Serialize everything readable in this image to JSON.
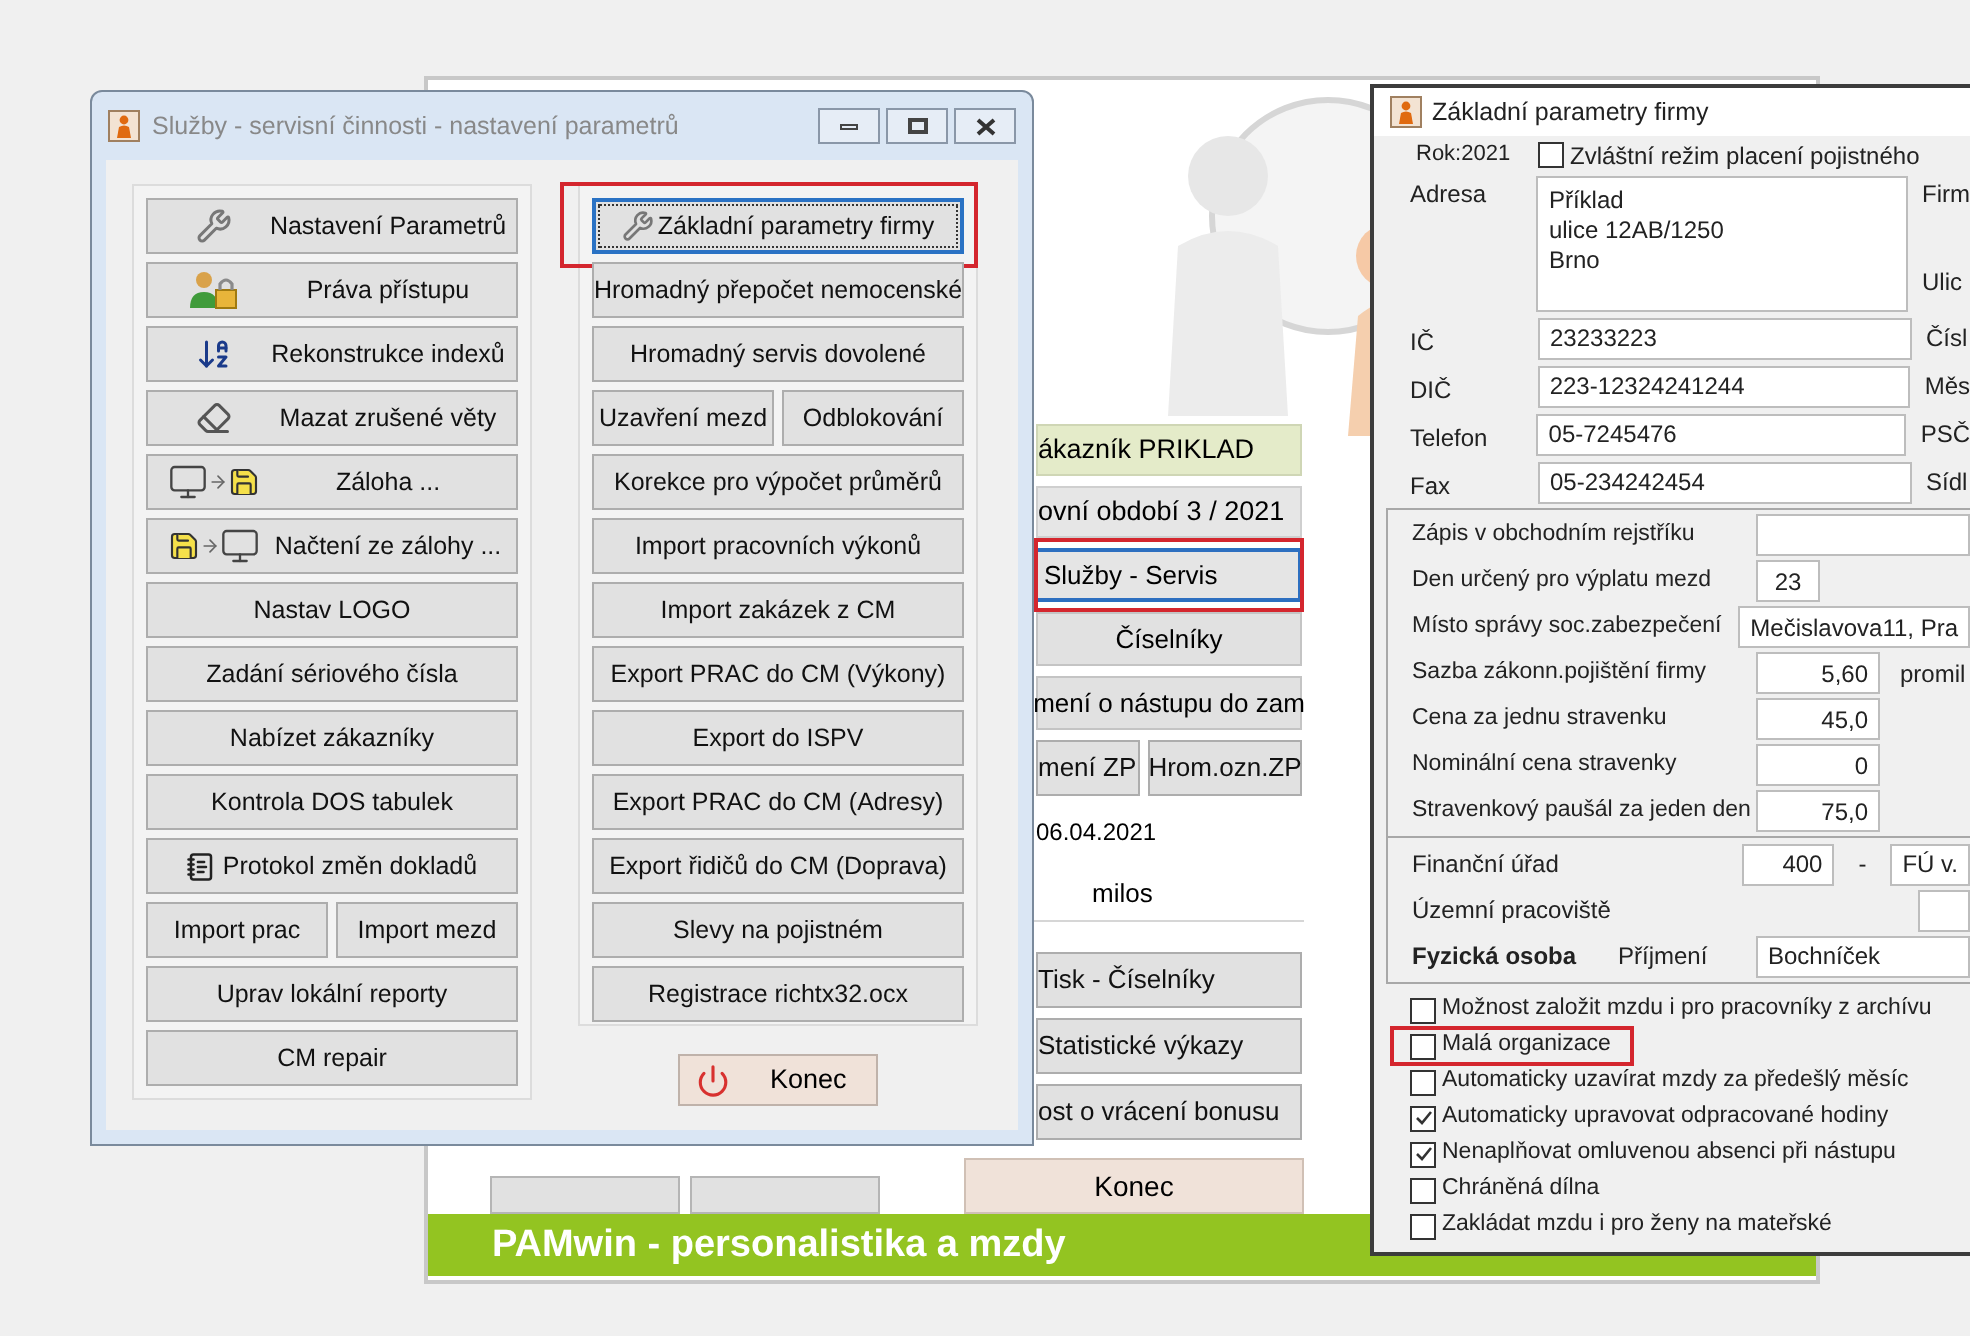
{
  "main_window": {
    "customer": "ákazník  PRIKLAD",
    "period": "ovní období  3 / 2021",
    "menu": [
      {
        "label": "Služby - Servis",
        "selected": true,
        "highlighted": true
      },
      {
        "label": "Číselníky",
        "selected": false,
        "highlighted": false
      },
      {
        "label": "mení o nástupu do zam",
        "selected": false,
        "highlighted": false
      }
    ],
    "pair": [
      "mení ZP",
      "Hrom.ozn.ZP"
    ],
    "date": "06.04.2021",
    "user": "milos",
    "actions": [
      "Tisk - Číselníky",
      "Statistické výkazy",
      "ost o vrácení bonusu"
    ],
    "exit": "Konec",
    "banner": "PAMwin - personalistika a mzdy"
  },
  "service_window": {
    "title": "Služby - servisní činnosti - nastavení parametrů",
    "left": [
      {
        "kind": "single",
        "label": "Nastavení Parametrů"
      },
      {
        "kind": "single",
        "label": "Práva přístupu"
      },
      {
        "kind": "single",
        "label": "Rekonstrukce indexů"
      },
      {
        "kind": "single",
        "label": "Mazat zrušené věty"
      },
      {
        "kind": "single",
        "label": "Záloha ..."
      },
      {
        "kind": "single",
        "label": "Načtení ze zálohy ..."
      },
      {
        "kind": "single",
        "label": "Nastav LOGO"
      },
      {
        "kind": "single",
        "label": "Zadání sériového čísla"
      },
      {
        "kind": "single",
        "label": "Nabízet zákazníky"
      },
      {
        "kind": "single",
        "label": "Kontrola  DOS tabulek"
      },
      {
        "kind": "single",
        "label": "Protokol změn dokladů"
      },
      {
        "kind": "pair",
        "labels": [
          "Import prac",
          "Import  mezd"
        ]
      },
      {
        "kind": "single",
        "label": "Uprav lokální reporty"
      },
      {
        "kind": "single",
        "label": "CM repair"
      }
    ],
    "right": [
      {
        "kind": "single",
        "label": "Základní parametry firmy",
        "focused": true,
        "highlighted": true
      },
      {
        "kind": "single",
        "label": "Hromadný přepočet nemocenské",
        "focused": false,
        "highlighted": false
      },
      {
        "kind": "single",
        "label": "Hromadný servis dovolené",
        "focused": false,
        "highlighted": false
      },
      {
        "kind": "pair",
        "labels": [
          "Uzavření mezd",
          "Odblokování"
        ],
        "focused": false,
        "highlighted": false
      },
      {
        "kind": "single",
        "label": "Korekce pro výpočet průměrů",
        "focused": false,
        "highlighted": false
      },
      {
        "kind": "single",
        "label": "Import pracovních výkonů",
        "focused": false,
        "highlighted": false
      },
      {
        "kind": "single",
        "label": "Import zakázek z CM",
        "focused": false,
        "highlighted": false
      },
      {
        "kind": "single",
        "label": "Export PRAC do CM (Výkony)",
        "focused": false,
        "highlighted": false
      },
      {
        "kind": "single",
        "label": "Export do ISPV",
        "focused": false,
        "highlighted": false
      },
      {
        "kind": "single",
        "label": "Export PRAC do CM (Adresy)",
        "focused": false,
        "highlighted": false
      },
      {
        "kind": "single",
        "label": "Export řidičů do CM (Doprava)",
        "focused": false,
        "highlighted": false
      },
      {
        "kind": "single",
        "label": "Slevy na pojistném",
        "focused": false,
        "highlighted": false
      },
      {
        "kind": "single",
        "label": "Registrace richtx32.ocx",
        "focused": false,
        "highlighted": false
      }
    ],
    "exit": "Konec"
  },
  "firm_window": {
    "title": "Základní parametry firmy",
    "year": "Rok:2021",
    "special": {
      "label": "Zvláštní režim placení pojistného",
      "checked": false
    },
    "address": {
      "label": "Adresa",
      "lines": [
        "Příklad",
        "ulice 12AB/1250",
        "Brno"
      ],
      "side": [
        "Firm",
        "Ulic"
      ]
    },
    "contacts": [
      {
        "label": "IČ",
        "value": "23233223",
        "side": "Čísl"
      },
      {
        "label": "DIČ",
        "value": "223-12324241244",
        "side": "Měs"
      },
      {
        "label": "Telefon",
        "value": "05-7245476",
        "side": "PSČ"
      },
      {
        "label": "Fax",
        "value": "05-234242454",
        "side": "Sídl"
      }
    ],
    "settings": [
      {
        "kind": "wide",
        "label": "Zápis v obchodním rejstříku"
      },
      {
        "kind": "small",
        "label": "Den určený pro výplatu mezd",
        "value": "23"
      },
      {
        "kind": "wide",
        "label": "Místo správy  soc.zabezpečení",
        "value": "Mečislavova11, Pra"
      },
      {
        "kind": "number",
        "label": "Sazba zákonn.pojištění firmy",
        "value": "5,60",
        "unit": "promil"
      },
      {
        "kind": "number",
        "label": "Cena za jednu stravenku",
        "value": "45,0"
      },
      {
        "kind": "number",
        "label": "Nominální cena stravenky",
        "value": "0"
      },
      {
        "kind": "number",
        "label": "Stravenkový paušál za jeden den",
        "value": "75,0"
      }
    ],
    "office": {
      "label": "Finanční úřad",
      "code": "400",
      "dash": "-",
      "name": "FÚ v."
    },
    "branch": {
      "label": "Územní pracoviště"
    },
    "person": {
      "label": "Fyzická osoba",
      "surname_label": "Příjmení",
      "surname": "Bochníček"
    },
    "options": [
      {
        "label": "Možnost založit mzdu i pro pracovníky z archívu",
        "checked": false,
        "highlighted": false
      },
      {
        "label": "Malá organizace",
        "checked": false,
        "highlighted": true
      },
      {
        "label": "Automaticky uzavírat mzdy za předešlý měsíc",
        "checked": false,
        "highlighted": false
      },
      {
        "label": "Automaticky upravovat odpracované hodiny",
        "checked": true,
        "highlighted": false
      },
      {
        "label": "Nenaplňovat omluvenou absenci při nástupu",
        "checked": true,
        "highlighted": false
      },
      {
        "label": "Chráněná dílna",
        "checked": false,
        "highlighted": false
      },
      {
        "label": "Zakládat mzdu i pro ženy na mateřské",
        "checked": false,
        "highlighted": false
      }
    ]
  }
}
